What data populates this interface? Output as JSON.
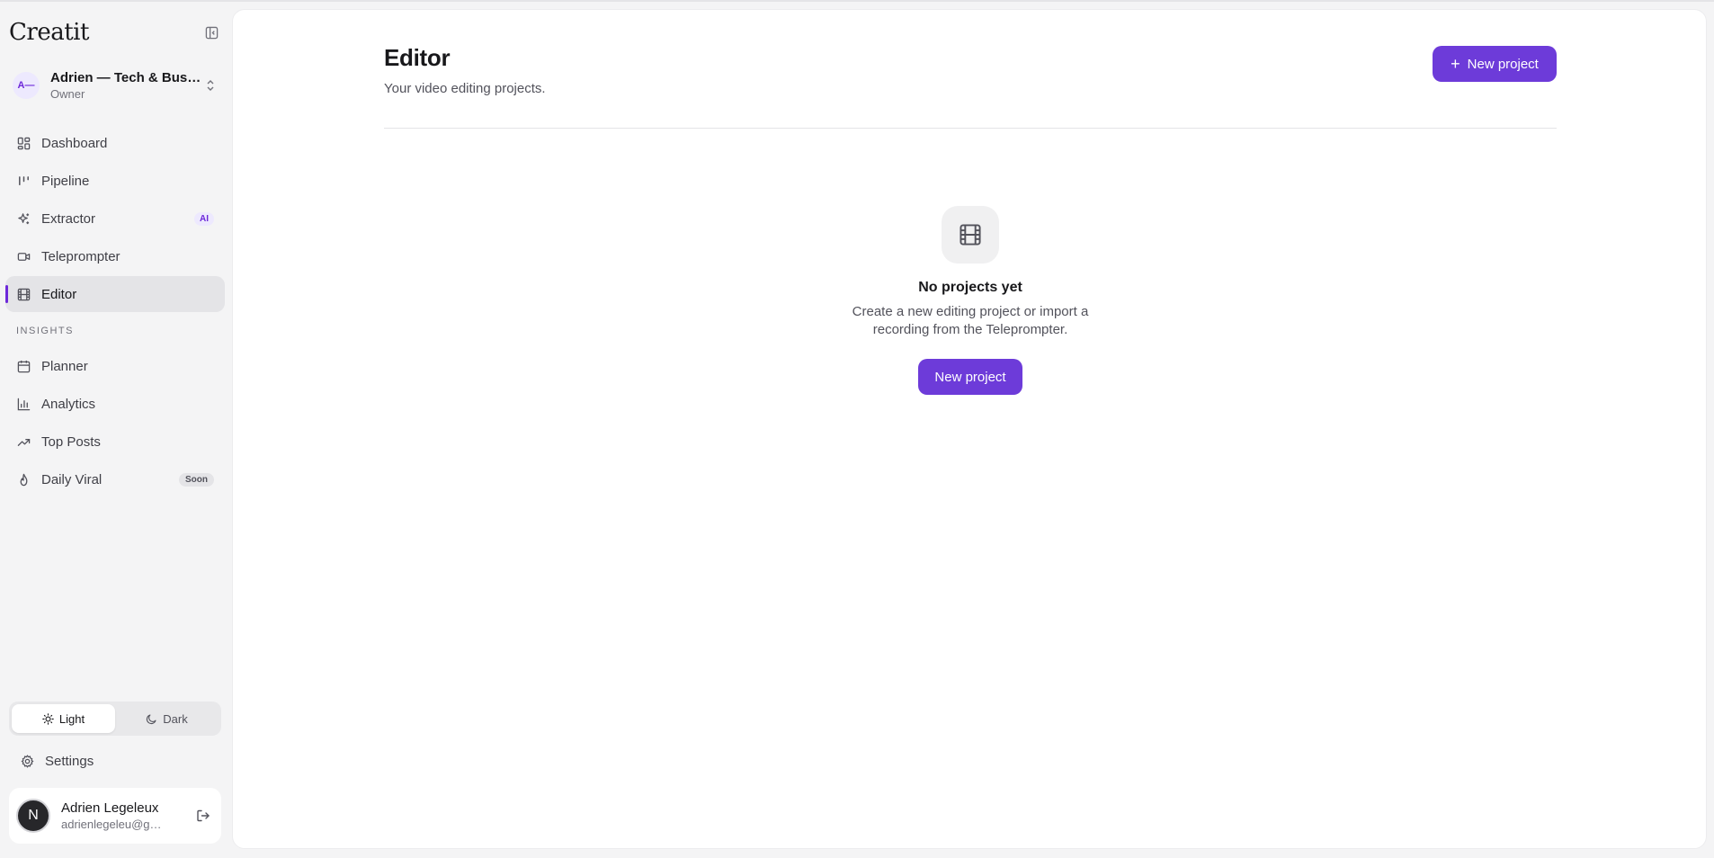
{
  "app": {
    "brand": "Creatit"
  },
  "workspace": {
    "avatar": "A—",
    "name": "Adrien — Tech & Business",
    "role": "Owner"
  },
  "nav": {
    "main": [
      {
        "label": "Dashboard",
        "icon": "dashboard-icon"
      },
      {
        "label": "Pipeline",
        "icon": "pipeline-icon"
      },
      {
        "label": "Extractor",
        "icon": "sparkles-icon",
        "badge": "AI"
      },
      {
        "label": "Teleprompter",
        "icon": "video-camera-icon"
      },
      {
        "label": "Editor",
        "icon": "film-icon",
        "active": true
      }
    ],
    "section_label": "INSIGHTS",
    "insights": [
      {
        "label": "Planner",
        "icon": "calendar-icon"
      },
      {
        "label": "Analytics",
        "icon": "bar-chart-icon"
      },
      {
        "label": "Top Posts",
        "icon": "trending-up-icon"
      },
      {
        "label": "Daily Viral",
        "icon": "flame-icon",
        "badge": "Soon"
      }
    ]
  },
  "theme": {
    "light_label": "Light",
    "dark_label": "Dark",
    "selected": "light"
  },
  "settings_label": "Settings",
  "user": {
    "avatar": "N",
    "name": "Adrien Legeleux",
    "email": "adrienlegeleu@gmail.com"
  },
  "page": {
    "title": "Editor",
    "subtitle": "Your video editing projects.",
    "new_project_label": "New project"
  },
  "empty_state": {
    "icon": "film-icon",
    "title": "No projects yet",
    "description": "Create a new editing project or import a recording from the Teleprompter.",
    "button_label": "New project"
  },
  "colors": {
    "accent": "#6d3bd9",
    "sidebar_bg": "#f4f4f5",
    "panel_bg": "#ffffff"
  }
}
